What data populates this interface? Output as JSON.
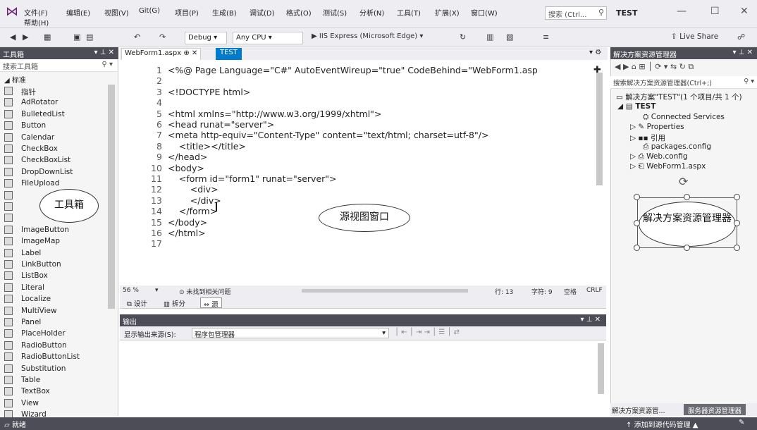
{
  "menu": {
    "items": [
      "文件(F)",
      "编辑(E)",
      "视图(V)",
      "Git(G)",
      "项目(P)",
      "生成(B)",
      "调试(D)",
      "格式(O)",
      "测试(S)",
      "分析(N)",
      "工具(T)",
      "扩展(X)",
      "窗口(W)"
    ],
    "help": "帮助(H)",
    "search_placeholder": "搜索 (Ctrl...",
    "solution_name": "TEST"
  },
  "toolbar": {
    "config": "Debug",
    "platform": "Any CPU",
    "run": "IIS Express (Microsoft Edge)",
    "live_share": "Live Share"
  },
  "toolbox": {
    "title": "工具箱",
    "search": "搜索工具箱",
    "group": "标准",
    "items": [
      "指针",
      "AdRotator",
      "BulletedList",
      "Button",
      "Calendar",
      "CheckBox",
      "CheckBoxList",
      "DropDownList",
      "FileUpload",
      "",
      "",
      "",
      "ImageButton",
      "ImageMap",
      "Label",
      "LinkButton",
      "ListBox",
      "Literal",
      "Localize",
      "MultiView",
      "Panel",
      "PlaceHolder",
      "RadioButton",
      "RadioButtonList",
      "Substitution",
      "Table",
      "TextBox",
      "View",
      "Wizard"
    ]
  },
  "editor": {
    "tab_active": "WebForm1.aspx",
    "tab_other": "TEST",
    "line_numbers": [
      "1",
      "2",
      "3",
      "4",
      "5",
      "6",
      "7",
      "8",
      "9",
      "10",
      "11",
      "12",
      "13",
      "14",
      "15",
      "16",
      "17"
    ],
    "lines": [
      "<%@ Page Language=\"C#\" AutoEventWireup=\"true\" CodeBehind=\"WebForm1.asp",
      "",
      "<!DOCTYPE html>",
      "",
      "<html xmlns=\"http://www.w3.org/1999/xhtml\">",
      "<head runat=\"server\">",
      "<meta http-equiv=\"Content-Type\" content=\"text/html; charset=utf-8\"/>",
      "    <title></title>",
      "</head>",
      "<body>",
      "    <form id=\"form1\" runat=\"server\">",
      "        <div>",
      "        </div>",
      "    </form>",
      "</body>",
      "</html>",
      ""
    ],
    "zoom": "56 %",
    "issues": "未找到相关问题",
    "row": "行: 13",
    "char": "字符: 9",
    "space": "空格",
    "eol": "CRLF",
    "view_design": "设计",
    "view_split": "拆分",
    "view_source": "源"
  },
  "output": {
    "title": "输出",
    "source_label": "显示输出来源(S):",
    "source_value": "程序包管理器"
  },
  "solution": {
    "title": "解决方案资源管理器",
    "search": "搜索解决方案资源管理器(Ctrl+;)",
    "root": "解决方案\"TEST\"(1 个项目/共 1 个)",
    "project": "TEST",
    "nodes": [
      "Connected Services",
      "Properties",
      "引用",
      "packages.config",
      "Web.config",
      "WebForm1.aspx"
    ],
    "tab_active": "解决方案资源管...",
    "tab_other": "服务器资源管理器"
  },
  "status": {
    "ready": "就绪",
    "source_control": "↑ 添加到源代码管理 ▲"
  },
  "annotations": {
    "toolbox": "工具箱",
    "source": "源视图窗口",
    "solution": "解决方案资源管理器"
  }
}
